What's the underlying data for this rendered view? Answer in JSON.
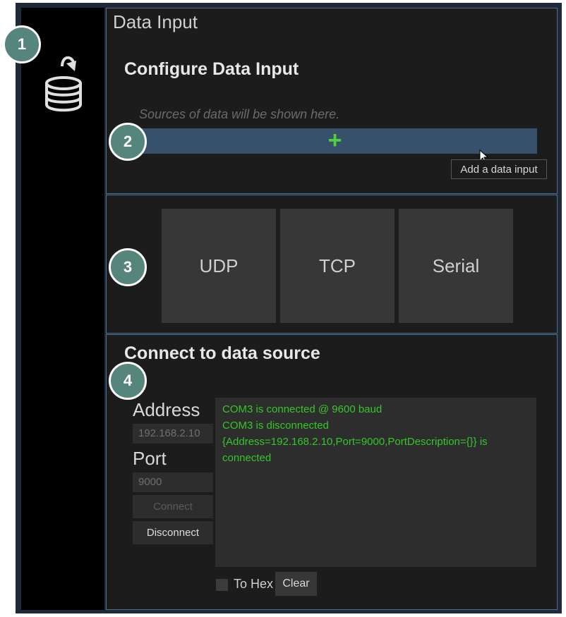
{
  "window": {
    "title": "Data Input"
  },
  "badges": [
    "1",
    "2",
    "3",
    "4"
  ],
  "configure": {
    "title": "Configure Data Input",
    "placeholder": "Sources of data will be shown here.",
    "add_icon": "plus-icon",
    "tooltip": "Add a data input"
  },
  "protocols": [
    {
      "label": "UDP"
    },
    {
      "label": "TCP"
    },
    {
      "label": "Serial"
    }
  ],
  "connect": {
    "title": "Connect to data source",
    "address_label": "Address",
    "address_value": "192.168.2.10",
    "port_label": "Port",
    "port_value": "9000",
    "connect_label": "Connect",
    "disconnect_label": "Disconnect",
    "log": [
      "COM3 is connected @ 9600 baud",
      "COM3 is disconnected",
      "{Address=192.168.2.10,Port=9000,PortDescription={}} is connected"
    ],
    "to_hex_label": "To Hex",
    "clear_label": "Clear"
  },
  "colors": {
    "accent_blue": "#37506b",
    "badge_teal": "#56857c",
    "log_green": "#35c62a",
    "plus_green": "#4ed13a"
  },
  "icons": [
    "database-icon",
    "plus-icon",
    "cursor-icon"
  ]
}
